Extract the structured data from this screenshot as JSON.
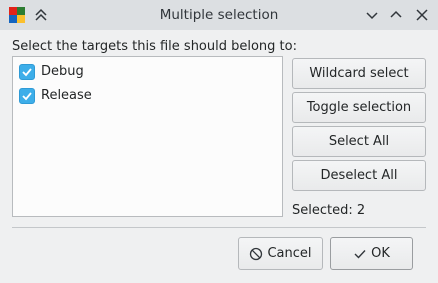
{
  "window": {
    "title": "Multiple selection"
  },
  "prompt": "Select the targets this file should belong to:",
  "targets": [
    {
      "label": "Debug",
      "checked": true
    },
    {
      "label": "Release",
      "checked": true
    }
  ],
  "buttons": {
    "wildcard_select": "Wildcard select",
    "toggle_selection": "Toggle selection",
    "select_all": "Select All",
    "deselect_all": "Deselect All",
    "cancel": "Cancel",
    "ok": "OK"
  },
  "status": {
    "selected_text": "Selected: 2"
  },
  "icons": {
    "app": "color-blocks-icon",
    "shade": "double-chevron-up-icon",
    "minimize": "chevron-down-icon",
    "maximize": "chevron-up-icon",
    "close": "close-icon",
    "cancel": "cancel-circle-icon",
    "ok": "checkmark-icon"
  },
  "colors": {
    "accent": "#3daee9",
    "titlebar": "#dcdfe2",
    "window_bg": "#eff0f1"
  }
}
